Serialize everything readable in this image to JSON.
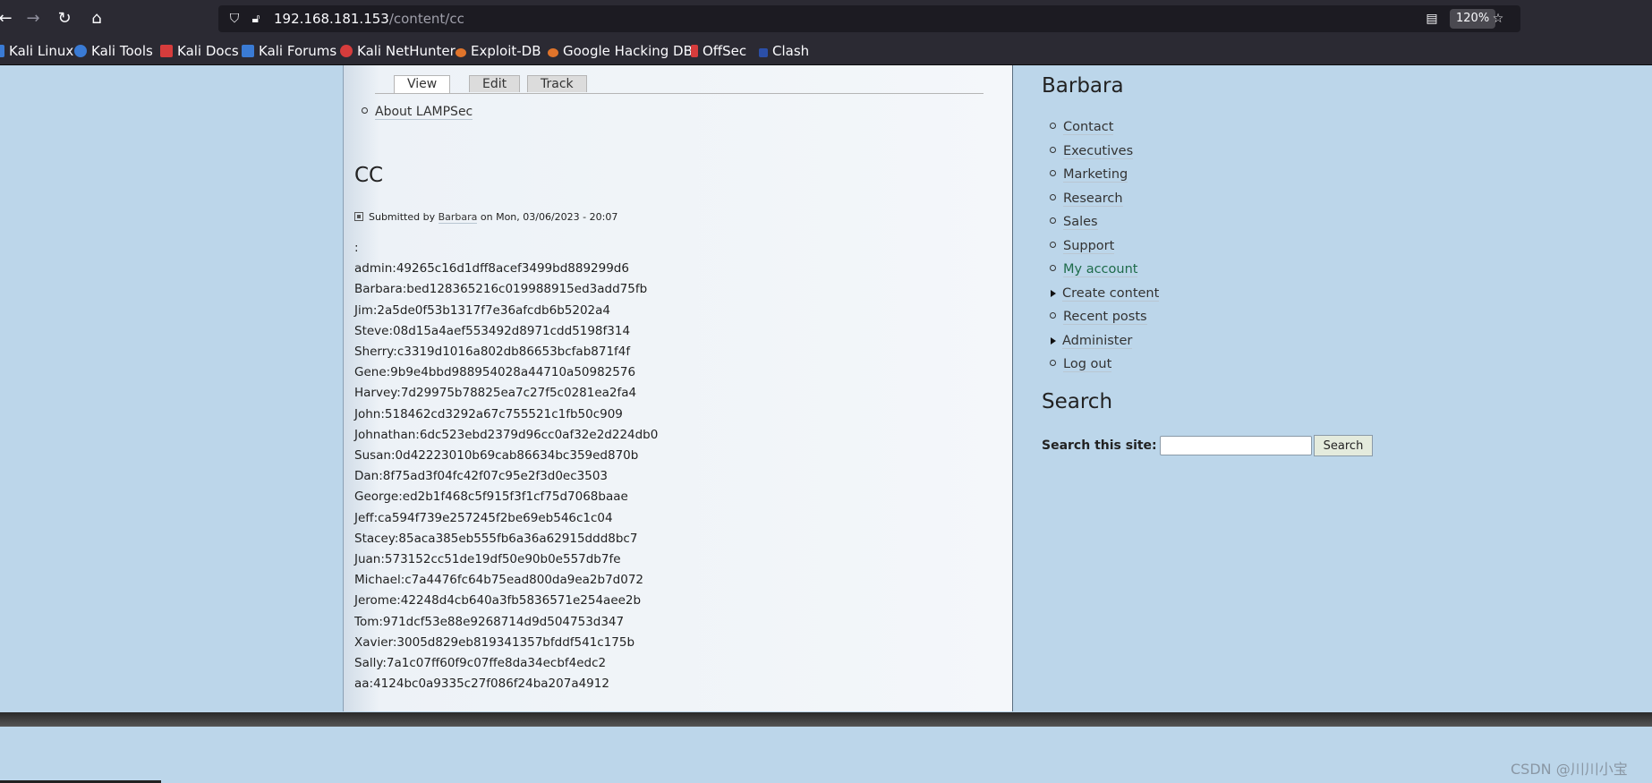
{
  "browser": {
    "url_host": "192.168.181.153",
    "url_path": "/content/cc",
    "zoom": "120%",
    "bookmarks": [
      {
        "label": "Kali Linux",
        "icon": "kali-dragon-icon",
        "color": "#3a7bd5"
      },
      {
        "label": "Kali Tools",
        "icon": "kali-tools-icon",
        "color": "#3a7bd5"
      },
      {
        "label": "Kali Docs",
        "icon": "kali-docs-icon",
        "color": "#d63c3c"
      },
      {
        "label": "Kali Forums",
        "icon": "kali-forums-icon",
        "color": "#3a7bd5"
      },
      {
        "label": "Kali NetHunter",
        "icon": "nethunter-icon",
        "color": "#d63c3c"
      },
      {
        "label": "Exploit-DB",
        "icon": "exploit-db-icon",
        "color": "#e0742b"
      },
      {
        "label": "Google Hacking DB",
        "icon": "ghdb-icon",
        "color": "#e0742b"
      },
      {
        "label": "OffSec",
        "icon": "offsec-icon",
        "color": "#d63c3c"
      },
      {
        "label": "Clash",
        "icon": "clash-icon",
        "color": "#2b4fa8"
      }
    ]
  },
  "tabs": [
    "View",
    "Edit",
    "Track"
  ],
  "secondary_links": [
    "About LAMPSec"
  ],
  "node": {
    "title": "CC",
    "submitted_prefix": "Submitted by",
    "author": "Barbara",
    "submitted_suffix": "on Mon, 03/06/2023 - 20:07",
    "body_lines": [
      ":",
      "admin:49265c16d1dff8acef3499bd889299d6",
      "Barbara:bed128365216c019988915ed3add75fb",
      "Jim:2a5de0f53b1317f7e36afcdb6b5202a4",
      "Steve:08d15a4aef553492d8971cdd5198f314",
      "Sherry:c3319d1016a802db86653bcfab871f4f",
      "Gene:9b9e4bbd988954028a44710a50982576",
      "Harvey:7d29975b78825ea7c27f5c0281ea2fa4",
      "John:518462cd3292a67c755521c1fb50c909",
      "Johnathan:6dc523ebd2379d96cc0af32e2d224db0",
      "Susan:0d42223010b69cab86634bc359ed870b",
      "Dan:8f75ad3f04fc42f07c95e2f3d0ec3503",
      "George:ed2b1f468c5f915f3f1cf75d7068baae",
      "Jeff:ca594f739e257245f2be69eb546c1c04",
      "Stacey:85aca385eb555fb6a36a62915ddd8bc7",
      "Juan:573152cc51de19df50e90b0e557db7fe",
      "Michael:c7a4476fc64b75ead800da9ea2b7d072",
      "Jerome:42248d4cb640a3fb5836571e254aee2b",
      "Tom:971dcf53e88e9268714d9d504753d347",
      "Xavier:3005d829eb819341357bfddf541c175b",
      "Sally:7a1c07ff60f9c07ffe8da34ecbf4edc2",
      "aa:4124bc0a9335c27f086f24ba207a4912"
    ]
  },
  "sidebar": {
    "user_block_title": "Barbara",
    "nav": [
      {
        "label": "Contact",
        "bullet": "circle"
      },
      {
        "label": "Executives",
        "bullet": "circle"
      },
      {
        "label": "Marketing",
        "bullet": "circle"
      },
      {
        "label": "Research",
        "bullet": "circle"
      },
      {
        "label": "Sales",
        "bullet": "circle"
      },
      {
        "label": "Support",
        "bullet": "circle"
      },
      {
        "label": "My account",
        "bullet": "circle",
        "active": true
      },
      {
        "label": "Create content",
        "bullet": "triangle"
      },
      {
        "label": "Recent posts",
        "bullet": "circle"
      },
      {
        "label": "Administer",
        "bullet": "triangle"
      },
      {
        "label": "Log out",
        "bullet": "circle"
      }
    ],
    "search_block_title": "Search",
    "search_label": "Search this site:",
    "search_value": "",
    "search_button": "Search"
  },
  "watermark": "CSDN @川川小宝"
}
